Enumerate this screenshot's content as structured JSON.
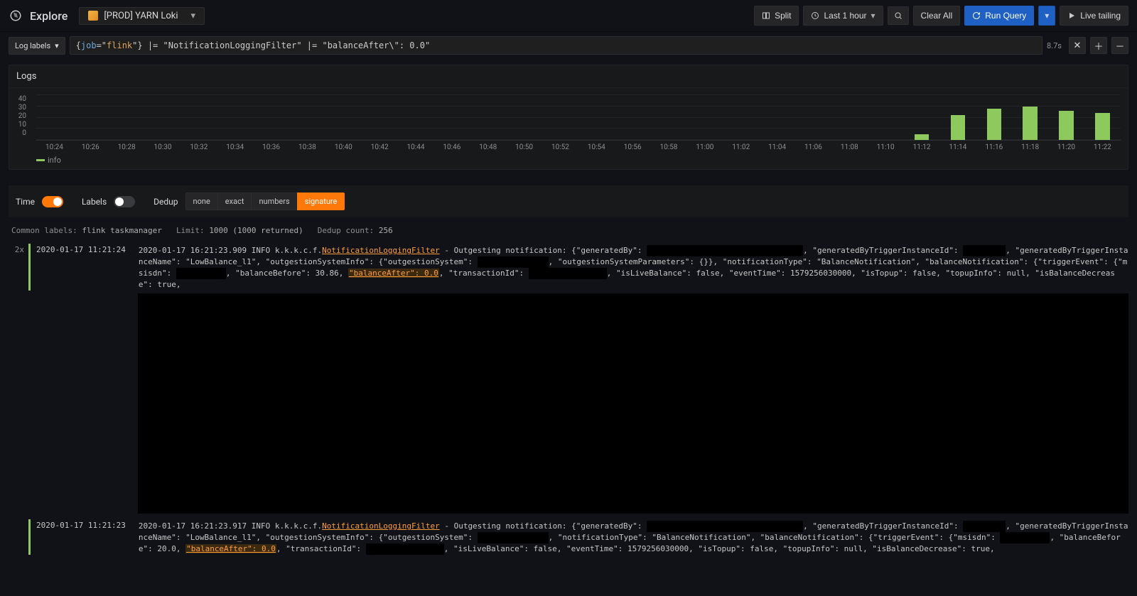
{
  "header": {
    "title": "Explore",
    "datasource": "[PROD] YARN Loki",
    "split": "Split",
    "time_range": "Last 1 hour",
    "clear_all": "Clear All",
    "run_query": "Run Query",
    "live_tailing": "Live tailing"
  },
  "query": {
    "label_button": "Log labels",
    "expr_prefix": "{",
    "expr_key": "job",
    "expr_eq": "=\"",
    "expr_val": "flink",
    "expr_suffix": "\"}",
    "pipe1": " |= \"NotificationLoggingFilter\" |= \"balanceAfter\\\": 0.0\"",
    "elapsed": "8.7s"
  },
  "logs_panel": {
    "title": "Logs",
    "legend": "info"
  },
  "chart_data": {
    "type": "bar",
    "title": "Logs",
    "xlabel": "",
    "ylabel": "",
    "ylim": [
      0,
      40
    ],
    "yticks": [
      0,
      10,
      20,
      30,
      40
    ],
    "categories": [
      "10:24",
      "10:26",
      "10:28",
      "10:30",
      "10:32",
      "10:34",
      "10:36",
      "10:38",
      "10:40",
      "10:42",
      "10:44",
      "10:46",
      "10:48",
      "10:50",
      "10:52",
      "10:54",
      "10:56",
      "10:58",
      "11:00",
      "11:02",
      "11:04",
      "11:06",
      "11:08",
      "11:10",
      "11:12",
      "11:14",
      "11:16",
      "11:18",
      "11:20",
      "11:22"
    ],
    "values": [
      0,
      0,
      0,
      0,
      0,
      0,
      0,
      0,
      0,
      0,
      0,
      0,
      0,
      0,
      0,
      0,
      0,
      0,
      0,
      0,
      0,
      0,
      0,
      0,
      5,
      22,
      28,
      30,
      26,
      24
    ],
    "series_name": "info",
    "color": "#8ec95e"
  },
  "controls": {
    "time_label": "Time",
    "time_on": true,
    "labels_label": "Labels",
    "labels_on": false,
    "dedup_label": "Dedup",
    "dedup_options": [
      "none",
      "exact",
      "numbers",
      "signature"
    ],
    "dedup_active": "signature"
  },
  "meta": {
    "common_labels_label": "Common labels:",
    "common_labels_value": "flink taskmanager",
    "limit_label": "Limit:",
    "limit_value": "1000 (1000 returned)",
    "dedup_count_label": "Dedup count:",
    "dedup_count_value": "256"
  },
  "log_entries": [
    {
      "dup": "2x",
      "ts": "2020-01-17 11:21:24",
      "line_prefix": "2020-01-17 16:21:23.909 INFO k.k.k.c.f.",
      "filter_name": "NotificationLoggingFilter",
      "after_filter": " - Outgesting notification: {\"generatedBy\": ",
      "part2": ", \"generatedByTriggerInstanceId\": ",
      "part3": ", \"generatedByTriggerInstanceName\": \"LowBalance_l1\", \"outgestionSystemInfo\": {\"outgestionSystem\": ",
      "part4": ", \"outgestionSystemParameters\": {}}, \"notificationType\": \"BalanceNotification\", \"balanceNotification\": {\"triggerEvent\": {\"msisdn\": ",
      "part5": ", \"balanceBefore\": 30.86, ",
      "balance_after": "\"balanceAfter\": 0.0",
      "part6": ", \"transactionId\": ",
      "part7": ", \"isLiveBalance\": false, \"eventTime\": 1579256030000, \"isTopup\": false, \"topupInfo\": null, \"isBalanceDecrease\": true,"
    },
    {
      "dup": "",
      "ts": "2020-01-17 11:21:23",
      "line_prefix": "2020-01-17 16:21:23.917 INFO k.k.k.c.f.",
      "filter_name": "NotificationLoggingFilter",
      "after_filter": " - Outgesting notification: {\"generatedBy\": ",
      "part2": ", \"generatedByTriggerInstanceId\": ",
      "part3": ", \"generatedByTriggerInstanceName\": \"LowBalance_l1\", \"outgestionSystemInfo\": {\"outgestionSystem\": ",
      "part4": ", \"notificationType\": \"BalanceNotification\", \"balanceNotification\": {\"triggerEvent\": {\"msisdn\": ",
      "part5": ", \"balanceBefore\": 20.0, ",
      "balance_after": "\"balanceAfter\": 0.0",
      "part6": ", \"transactionId\": ",
      "part7": ", \"isLiveBalance\": false, \"eventTime\": 1579256030000, \"isTopup\": false, \"topupInfo\": null, \"isBalanceDecrease\": true,"
    }
  ]
}
